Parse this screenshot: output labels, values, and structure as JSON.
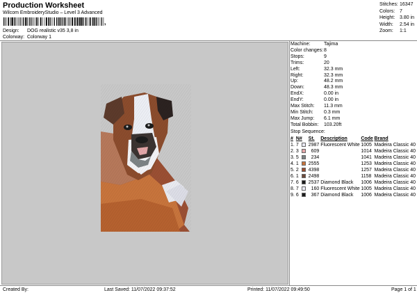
{
  "header": {
    "title": "Production Worksheet",
    "subtitle": "Wilcom EmbroideryStudio – Level 3 Advanced",
    "barcode_tail": ","
  },
  "meta": {
    "design_label": "Design:",
    "design_value": "DOG realistic v35 3,8 in",
    "colorway_label": "Colorway:",
    "colorway_value": "Colorway 1"
  },
  "stats": [
    {
      "label": "Stitches:",
      "value": "16347"
    },
    {
      "label": "Colors:",
      "value": "7"
    },
    {
      "label": "Height:",
      "value": "3.80 in"
    },
    {
      "label": "Width:",
      "value": "2.54 in"
    },
    {
      "label": "Zoom:",
      "value": "1:1"
    }
  ],
  "machine_stats": [
    {
      "label": "Machine:",
      "value": "Tajima"
    },
    {
      "label": "Color changes:",
      "value": "8"
    },
    {
      "label": "Stops:",
      "value": "9"
    },
    {
      "label": "Trims:",
      "value": "20"
    },
    {
      "label": "Left:",
      "value": "32.3 mm"
    },
    {
      "label": "Right:",
      "value": "32.3 mm"
    },
    {
      "label": "Up:",
      "value": "48.2 mm"
    },
    {
      "label": "Down:",
      "value": "48.3 mm"
    },
    {
      "label": "EndX:",
      "value": "0.00 in"
    },
    {
      "label": "EndY:",
      "value": "0.00 in"
    },
    {
      "label": "Max Stitch:",
      "value": "11.3 mm"
    },
    {
      "label": "Min Stitch:",
      "value": "0.3 mm"
    },
    {
      "label": "Max Jump:",
      "value": "6.1 mm"
    },
    {
      "label": "Total Bobbin:",
      "value": "103.20ft"
    }
  ],
  "sequence": {
    "title": "Stop Sequence:",
    "headers": [
      "#",
      "N#",
      "St.",
      "Description",
      "Code",
      "Brand"
    ],
    "rows": [
      {
        "stop": "1.",
        "needle": "7",
        "color": "#eaeaf4",
        "stitches": "2987",
        "description": "Fluorescent White",
        "code": "1005",
        "brand": "Madeira Classic 40"
      },
      {
        "stop": "2.",
        "needle": "3",
        "color": "#e3a6a8",
        "stitches": "609",
        "description": "",
        "code": "1014",
        "brand": "Madeira Classic 40"
      },
      {
        "stop": "3.",
        "needle": "5",
        "color": "#7d8385",
        "stitches": "234",
        "description": "",
        "code": "1041",
        "brand": "Madeira Classic 40"
      },
      {
        "stop": "4.",
        "needle": "1",
        "color": "#c7743c",
        "stitches": "2555",
        "description": "",
        "code": "1253",
        "brand": "Madeira Classic 40"
      },
      {
        "stop": "5.",
        "needle": "2",
        "color": "#9a4f33",
        "stitches": "4398",
        "description": "",
        "code": "1257",
        "brand": "Madeira Classic 40"
      },
      {
        "stop": "6.",
        "needle": "1",
        "color": "#6e4a3a",
        "stitches": "2498",
        "description": "",
        "code": "1158",
        "brand": "Madeira Classic 40"
      },
      {
        "stop": "7.",
        "needle": "6",
        "color": "#1c1c1c",
        "stitches": "2537",
        "description": "Diamond Black",
        "code": "1006",
        "brand": "Madeira Classic 40"
      },
      {
        "stop": "8.",
        "needle": "7",
        "color": "#eaeaf4",
        "stitches": "160",
        "description": "Fluorescent White",
        "code": "1005",
        "brand": "Madeira Classic 40"
      },
      {
        "stop": "9.",
        "needle": "6",
        "color": "#1c1c1c",
        "stitches": "367",
        "description": "Diamond Black",
        "code": "1006",
        "brand": "Madeira Classic 40"
      }
    ]
  },
  "footer": {
    "created": "Created By:",
    "saved": "Last Saved: 11/07/2022 09:37:52",
    "printed": "Printed: 11/07/2022 09:49:50",
    "page": "Page 1 of 1"
  }
}
